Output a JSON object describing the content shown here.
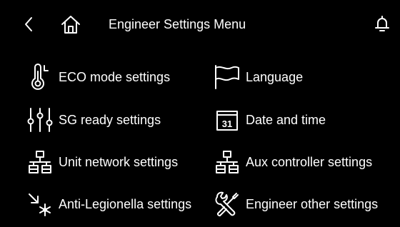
{
  "header": {
    "title": "Engineer Settings Menu",
    "back_icon": "chevron-left-icon",
    "home_icon": "home-icon",
    "bell_icon": "bell-icon"
  },
  "menu": {
    "items": [
      {
        "label": "ECO mode settings",
        "icon": "thermometer-icon"
      },
      {
        "label": "Language",
        "icon": "flag-icon"
      },
      {
        "label": "SG ready settings",
        "icon": "sliders-icon"
      },
      {
        "label": "Date and time",
        "icon": "calendar-icon",
        "icon_text": "31"
      },
      {
        "label": "Unit network settings",
        "icon": "network-icon"
      },
      {
        "label": "Aux controller settings",
        "icon": "network-icon"
      },
      {
        "label": "Anti-Legionella settings",
        "icon": "anti-legionella-icon"
      },
      {
        "label": "Engineer other settings",
        "icon": "tools-icon"
      }
    ]
  },
  "colors": {
    "background": "#000000",
    "foreground": "#ffffff"
  }
}
